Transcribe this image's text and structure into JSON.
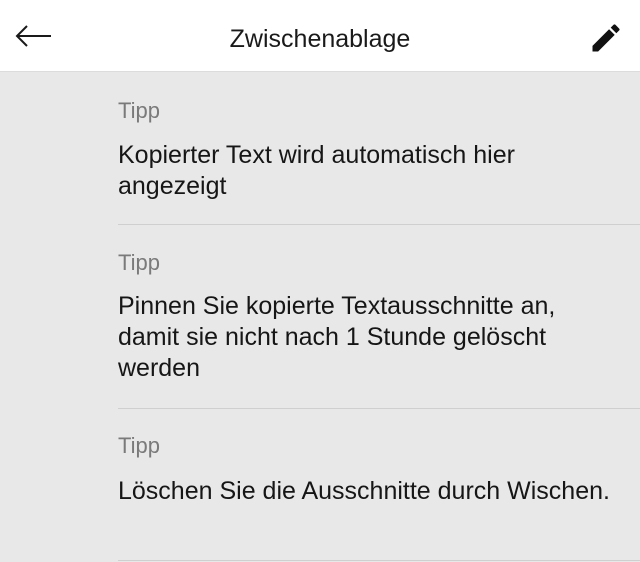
{
  "header": {
    "title": "Zwischenablage",
    "back_icon": "arrow-left-icon",
    "edit_icon": "pencil-icon"
  },
  "tips": [
    {
      "label": "Tipp",
      "text": "Kopierter Text wird automatisch hier angezeigt"
    },
    {
      "label": "Tipp",
      "text": "Pinnen Sie kopierte Textausschnitte an, damit sie nicht nach 1 Stunde gelöscht werden"
    },
    {
      "label": "Tipp",
      "text": "Löschen Sie die Ausschnitte durch Wischen."
    }
  ],
  "colors": {
    "background": "#e8e8e8",
    "header_background": "#ffffff",
    "label": "#7a7a7a",
    "text": "#161616"
  }
}
